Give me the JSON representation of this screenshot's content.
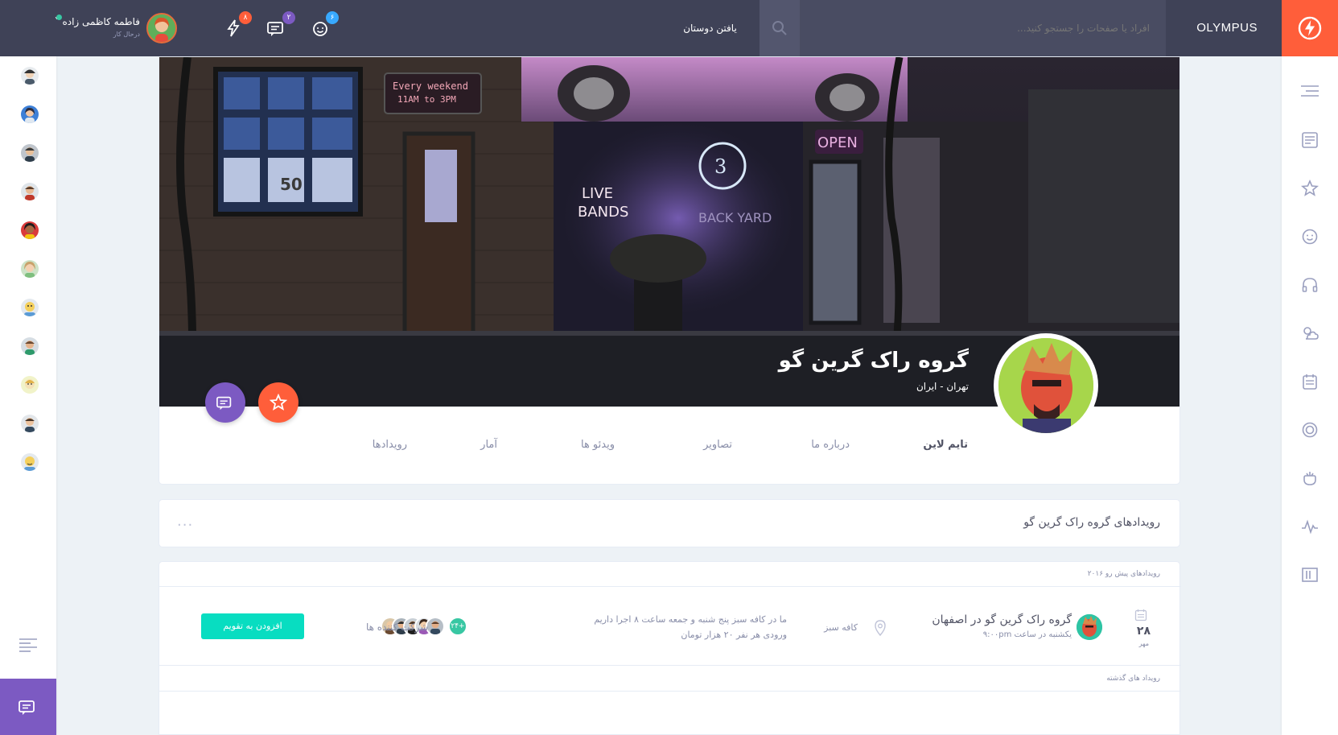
{
  "header": {
    "brand": "OLYMPUS",
    "search_placeholder": "افراد یا صفحات را جستجو کنید...",
    "find_friends": "یافتن دوستان",
    "badges": {
      "friends": "۶",
      "messages": "۲",
      "notifications": "۸"
    },
    "user": {
      "name": "فاطمه کاظمی زاده",
      "status": "درحال کار"
    }
  },
  "group": {
    "title": "گروه راک گرین گو",
    "location": "تهران - ایران",
    "tabs": [
      "تایم لاین",
      "درباره ما",
      "تصاویر",
      "ویدئو ها",
      "آمار",
      "رویدادها"
    ]
  },
  "events": {
    "title": "رویدادهای گروه راک گرین گو",
    "more": "...",
    "upcoming_label": "رویدادهای پیش رو ۲۰۱۶",
    "past_label": "رویداد های گذشته",
    "item": {
      "day": "۲۸",
      "month": "مهر",
      "name": "گروه راک گرین گو در اصفهان",
      "time": "یکشنبه در ساعت ۹:۰۰pm",
      "place": "کافه سبز",
      "description": "ما در کافه سبز پنج شنبه و جمعه ساعت ۸ اجرا داریم ورودی هر نفر ۲۰ هزار تومان",
      "attendee_count": "۲۴+",
      "attendee_label": "شرکت کننده ها",
      "add_button": "افزودن به تقویم"
    }
  },
  "colors": {
    "header_bg": "#3f4257",
    "accent_orange": "#ff5e3a",
    "accent_purple": "#7c5ac2",
    "accent_teal": "#08ddc1",
    "badge_blue": "#38a9ff"
  }
}
